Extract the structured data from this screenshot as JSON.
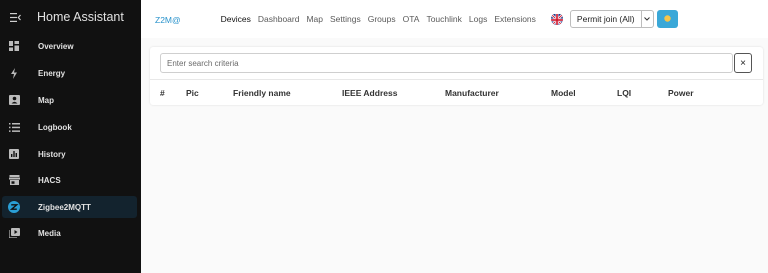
{
  "sidebar": {
    "title": "Home Assistant",
    "items": [
      {
        "label": "Overview",
        "icon": "dashboard-grid-icon"
      },
      {
        "label": "Energy",
        "icon": "lightning-icon"
      },
      {
        "label": "Map",
        "icon": "map-account-icon"
      },
      {
        "label": "Logbook",
        "icon": "list-icon"
      },
      {
        "label": "History",
        "icon": "chart-box-icon"
      },
      {
        "label": "HACS",
        "icon": "store-icon"
      },
      {
        "label": "Zigbee2MQTT",
        "icon": "zigbee-icon",
        "active": true
      },
      {
        "label": "Media",
        "icon": "play-box-icon"
      }
    ]
  },
  "topbar": {
    "brand": "Z2M@",
    "nav": [
      "Devices",
      "Dashboard",
      "Map",
      "Settings",
      "Groups",
      "OTA",
      "Touchlink",
      "Logs",
      "Extensions"
    ],
    "active_nav": "Devices",
    "language_flag": "uk-flag-icon",
    "permit_join_label": "Permit join (All)",
    "theme_icon": "sun-icon"
  },
  "devices": {
    "search_placeholder": "Enter search criteria",
    "clear_label": "×",
    "columns": [
      "#",
      "Pic",
      "Friendly name",
      "IEEE Address",
      "Manufacturer",
      "Model",
      "LQI",
      "Power"
    ],
    "rows": []
  },
  "colors": {
    "sidebar_bg": "#111111",
    "accent": "#2a93cc",
    "active_item_bg": "#13232e",
    "theme_button": "#3aa8d8"
  }
}
